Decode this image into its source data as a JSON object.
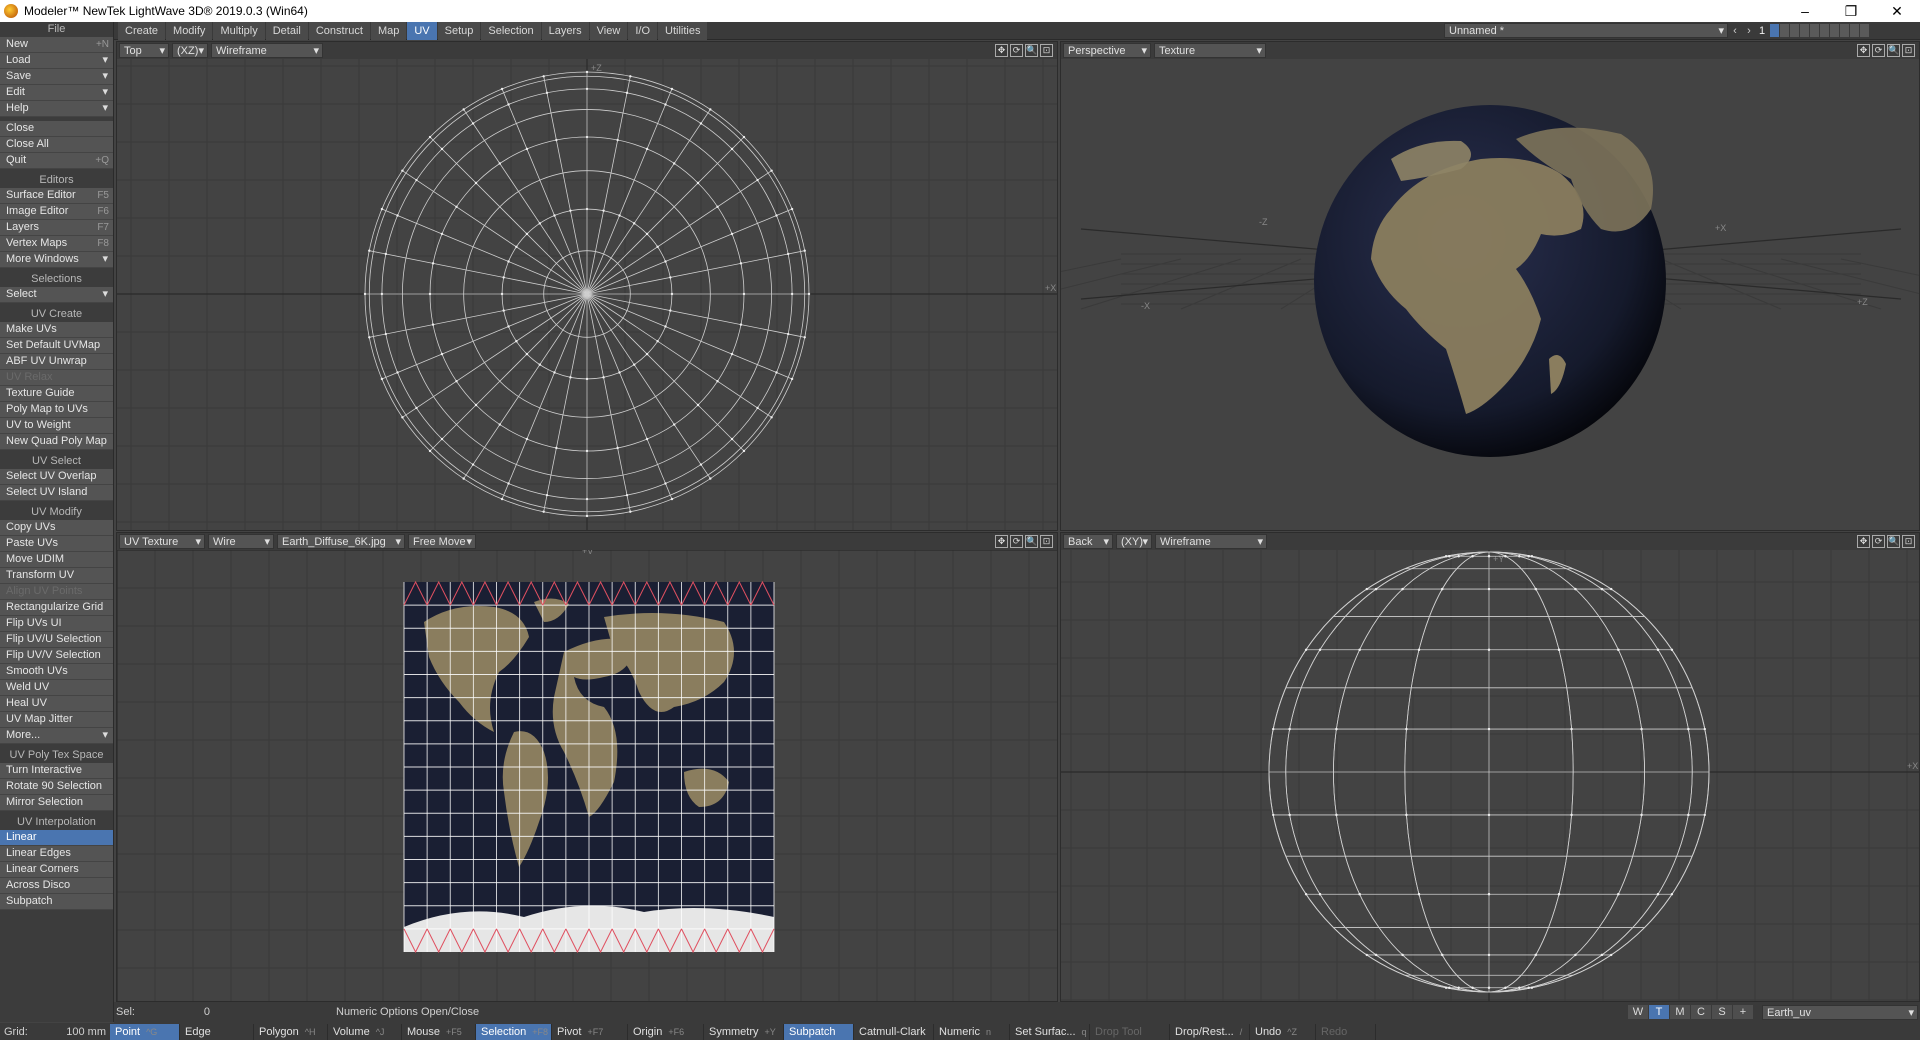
{
  "window": {
    "title": "Modeler™ NewTek LightWave 3D® 2019.0.3 (Win64)",
    "controls": [
      "–",
      "❐",
      "✕"
    ]
  },
  "menu_tabs": [
    {
      "label": "Create",
      "active": false
    },
    {
      "label": "Modify",
      "active": false
    },
    {
      "label": "Multiply",
      "active": false
    },
    {
      "label": "Detail",
      "active": false
    },
    {
      "label": "Construct",
      "active": false
    },
    {
      "label": "Map",
      "active": false
    },
    {
      "label": "UV",
      "active": true
    },
    {
      "label": "Setup",
      "active": false
    },
    {
      "label": "Selection",
      "active": false
    },
    {
      "label": "Layers",
      "active": false
    },
    {
      "label": "View",
      "active": false
    },
    {
      "label": "I/O",
      "active": false
    },
    {
      "label": "Utilities",
      "active": false
    }
  ],
  "object_selector": {
    "value": "Unnamed *",
    "layer": "1"
  },
  "sidebar": {
    "file_header": "File",
    "file_items": [
      {
        "label": "New",
        "shortcut": "+N",
        "dropdown": false
      },
      {
        "label": "Load",
        "shortcut": "",
        "dropdown": true
      },
      {
        "label": "Save",
        "shortcut": "",
        "dropdown": true
      },
      {
        "label": "Edit",
        "shortcut": "",
        "dropdown": true
      },
      {
        "label": "Help",
        "shortcut": "",
        "dropdown": true
      }
    ],
    "file_items2": [
      {
        "label": "Close",
        "shortcut": ""
      },
      {
        "label": "Close All",
        "shortcut": ""
      },
      {
        "label": "Quit",
        "shortcut": "+Q"
      }
    ],
    "sections": [
      {
        "header": "Editors",
        "items": [
          {
            "label": "Surface Editor",
            "shortcut": "F5"
          },
          {
            "label": "Image Editor",
            "shortcut": "F6"
          },
          {
            "label": "Layers",
            "shortcut": "F7"
          },
          {
            "label": "Vertex Maps",
            "shortcut": "F8"
          },
          {
            "label": "More Windows",
            "shortcut": "",
            "dropdown": true
          }
        ]
      },
      {
        "header": "Selections",
        "items": [
          {
            "label": "Select",
            "shortcut": "",
            "dropdown": true
          }
        ]
      },
      {
        "header": "UV Create",
        "items": [
          {
            "label": "Make UVs",
            "shortcut": ""
          },
          {
            "label": "Set Default UVMap",
            "shortcut": ""
          },
          {
            "label": "ABF UV Unwrap",
            "shortcut": ""
          },
          {
            "label": "UV Relax",
            "shortcut": "",
            "dim": true
          },
          {
            "label": "Texture Guide",
            "shortcut": ""
          },
          {
            "label": "Poly Map to UVs",
            "shortcut": ""
          },
          {
            "label": "UV to Weight",
            "shortcut": ""
          },
          {
            "label": "New Quad Poly Map",
            "shortcut": ""
          }
        ]
      },
      {
        "header": "UV Select",
        "items": [
          {
            "label": "Select UV Overlap",
            "shortcut": ""
          },
          {
            "label": "Select UV Island",
            "shortcut": ""
          }
        ]
      },
      {
        "header": "UV Modify",
        "items": [
          {
            "label": "Copy UVs",
            "shortcut": ""
          },
          {
            "label": "Paste UVs",
            "shortcut": ""
          },
          {
            "label": "Move UDIM",
            "shortcut": ""
          },
          {
            "label": "Transform UV",
            "shortcut": ""
          },
          {
            "label": "Align UV Points",
            "shortcut": "",
            "dim": true
          },
          {
            "label": "Rectangularize Grid",
            "shortcut": ""
          },
          {
            "label": "Flip UVs UI",
            "shortcut": ""
          },
          {
            "label": "Flip UV/U Selection",
            "shortcut": ""
          },
          {
            "label": "Flip UV/V Selection",
            "shortcut": ""
          },
          {
            "label": "Smooth UVs",
            "shortcut": ""
          },
          {
            "label": "Weld UV",
            "shortcut": ""
          },
          {
            "label": "Heal UV",
            "shortcut": ""
          },
          {
            "label": "UV Map Jitter",
            "shortcut": ""
          },
          {
            "label": "More...",
            "shortcut": "",
            "dropdown": true
          }
        ]
      },
      {
        "header": "UV Poly Tex Space",
        "items": [
          {
            "label": "Turn Interactive",
            "shortcut": ""
          },
          {
            "label": "Rotate 90 Selection",
            "shortcut": ""
          },
          {
            "label": "Mirror Selection",
            "shortcut": ""
          }
        ]
      },
      {
        "header": "UV Interpolation",
        "items": [
          {
            "label": "Linear",
            "shortcut": "",
            "active": true
          },
          {
            "label": "Linear Edges",
            "shortcut": ""
          },
          {
            "label": "Linear Corners",
            "shortcut": ""
          },
          {
            "label": "Across Disco",
            "shortcut": ""
          },
          {
            "label": "Subpatch",
            "shortcut": ""
          }
        ]
      }
    ]
  },
  "viewports": {
    "top_left": {
      "view": "Top",
      "axis": "(XZ)",
      "mode": "Wireframe",
      "axis_labels": [
        "+Z",
        "+X"
      ]
    },
    "top_right": {
      "view": "Perspective",
      "mode": "Texture",
      "axis_labels": [
        "-Z",
        "-X",
        "+Z",
        "+X"
      ]
    },
    "bottom_left": {
      "view": "UV Texture",
      "mode": "Wire",
      "image": "Earth_Diffuse_6K.jpg",
      "move": "Free Move",
      "axis_labels": [
        "+V"
      ]
    },
    "bottom_right": {
      "view": "Back",
      "axis": "(XY)",
      "mode": "Wireframe",
      "axis_labels": [
        "+Y",
        "+X"
      ]
    },
    "ctrl_icons": [
      "✥",
      "⟳",
      "🔍",
      "⊡"
    ]
  },
  "status": {
    "sel_label": "Sel:",
    "sel_value": "0",
    "message": "Numeric Options Open/Close",
    "grid_label": "Grid:",
    "grid_value": "100 mm"
  },
  "wtmcs": [
    {
      "label": "W",
      "on": false
    },
    {
      "label": "T",
      "on": true
    },
    {
      "label": "M",
      "on": false
    },
    {
      "label": "C",
      "on": false
    },
    {
      "label": "S",
      "on": false
    },
    {
      "label": "+",
      "on": false
    }
  ],
  "uvmap_selector": "Earth_uv",
  "tools": [
    {
      "label": "Point",
      "shortcut": "^G",
      "active": true
    },
    {
      "label": "Edge",
      "shortcut": "",
      "active": false
    },
    {
      "label": "Polygon",
      "shortcut": "^H",
      "active": false
    },
    {
      "label": "Volume",
      "shortcut": "^J",
      "active": false
    },
    {
      "label": "Mouse",
      "shortcut": "+F5",
      "active": false
    },
    {
      "label": "Selection",
      "shortcut": "+F8",
      "active": true
    },
    {
      "label": "Pivot",
      "shortcut": "+F7",
      "active": false
    },
    {
      "label": "Origin",
      "shortcut": "+F6",
      "active": false
    },
    {
      "label": "Symmetry",
      "shortcut": "+Y",
      "active": false
    },
    {
      "label": "Subpatch",
      "shortcut": "",
      "active": true
    },
    {
      "label": "Catmull-Clark",
      "shortcut": "",
      "active": false
    },
    {
      "label": "Numeric",
      "shortcut": "n",
      "active": false
    },
    {
      "label": "Set Surfac...",
      "shortcut": "q",
      "active": false
    },
    {
      "label": "Drop Tool",
      "shortcut": "",
      "active": false,
      "dim": true
    },
    {
      "label": "Drop/Rest...",
      "shortcut": "/",
      "active": false
    },
    {
      "label": "Undo",
      "shortcut": "^Z",
      "active": false
    },
    {
      "label": "Redo",
      "shortcut": "",
      "active": false,
      "dim": true
    }
  ],
  "colors": {
    "accent": "#4a75b0",
    "panel": "#3c3c3c",
    "button": "#545454",
    "viewport": "#434343",
    "grid": "#3a3a3a",
    "wire": "#cfcfcf",
    "ocean": "#1a1f33",
    "land": "#8a7d5e"
  }
}
